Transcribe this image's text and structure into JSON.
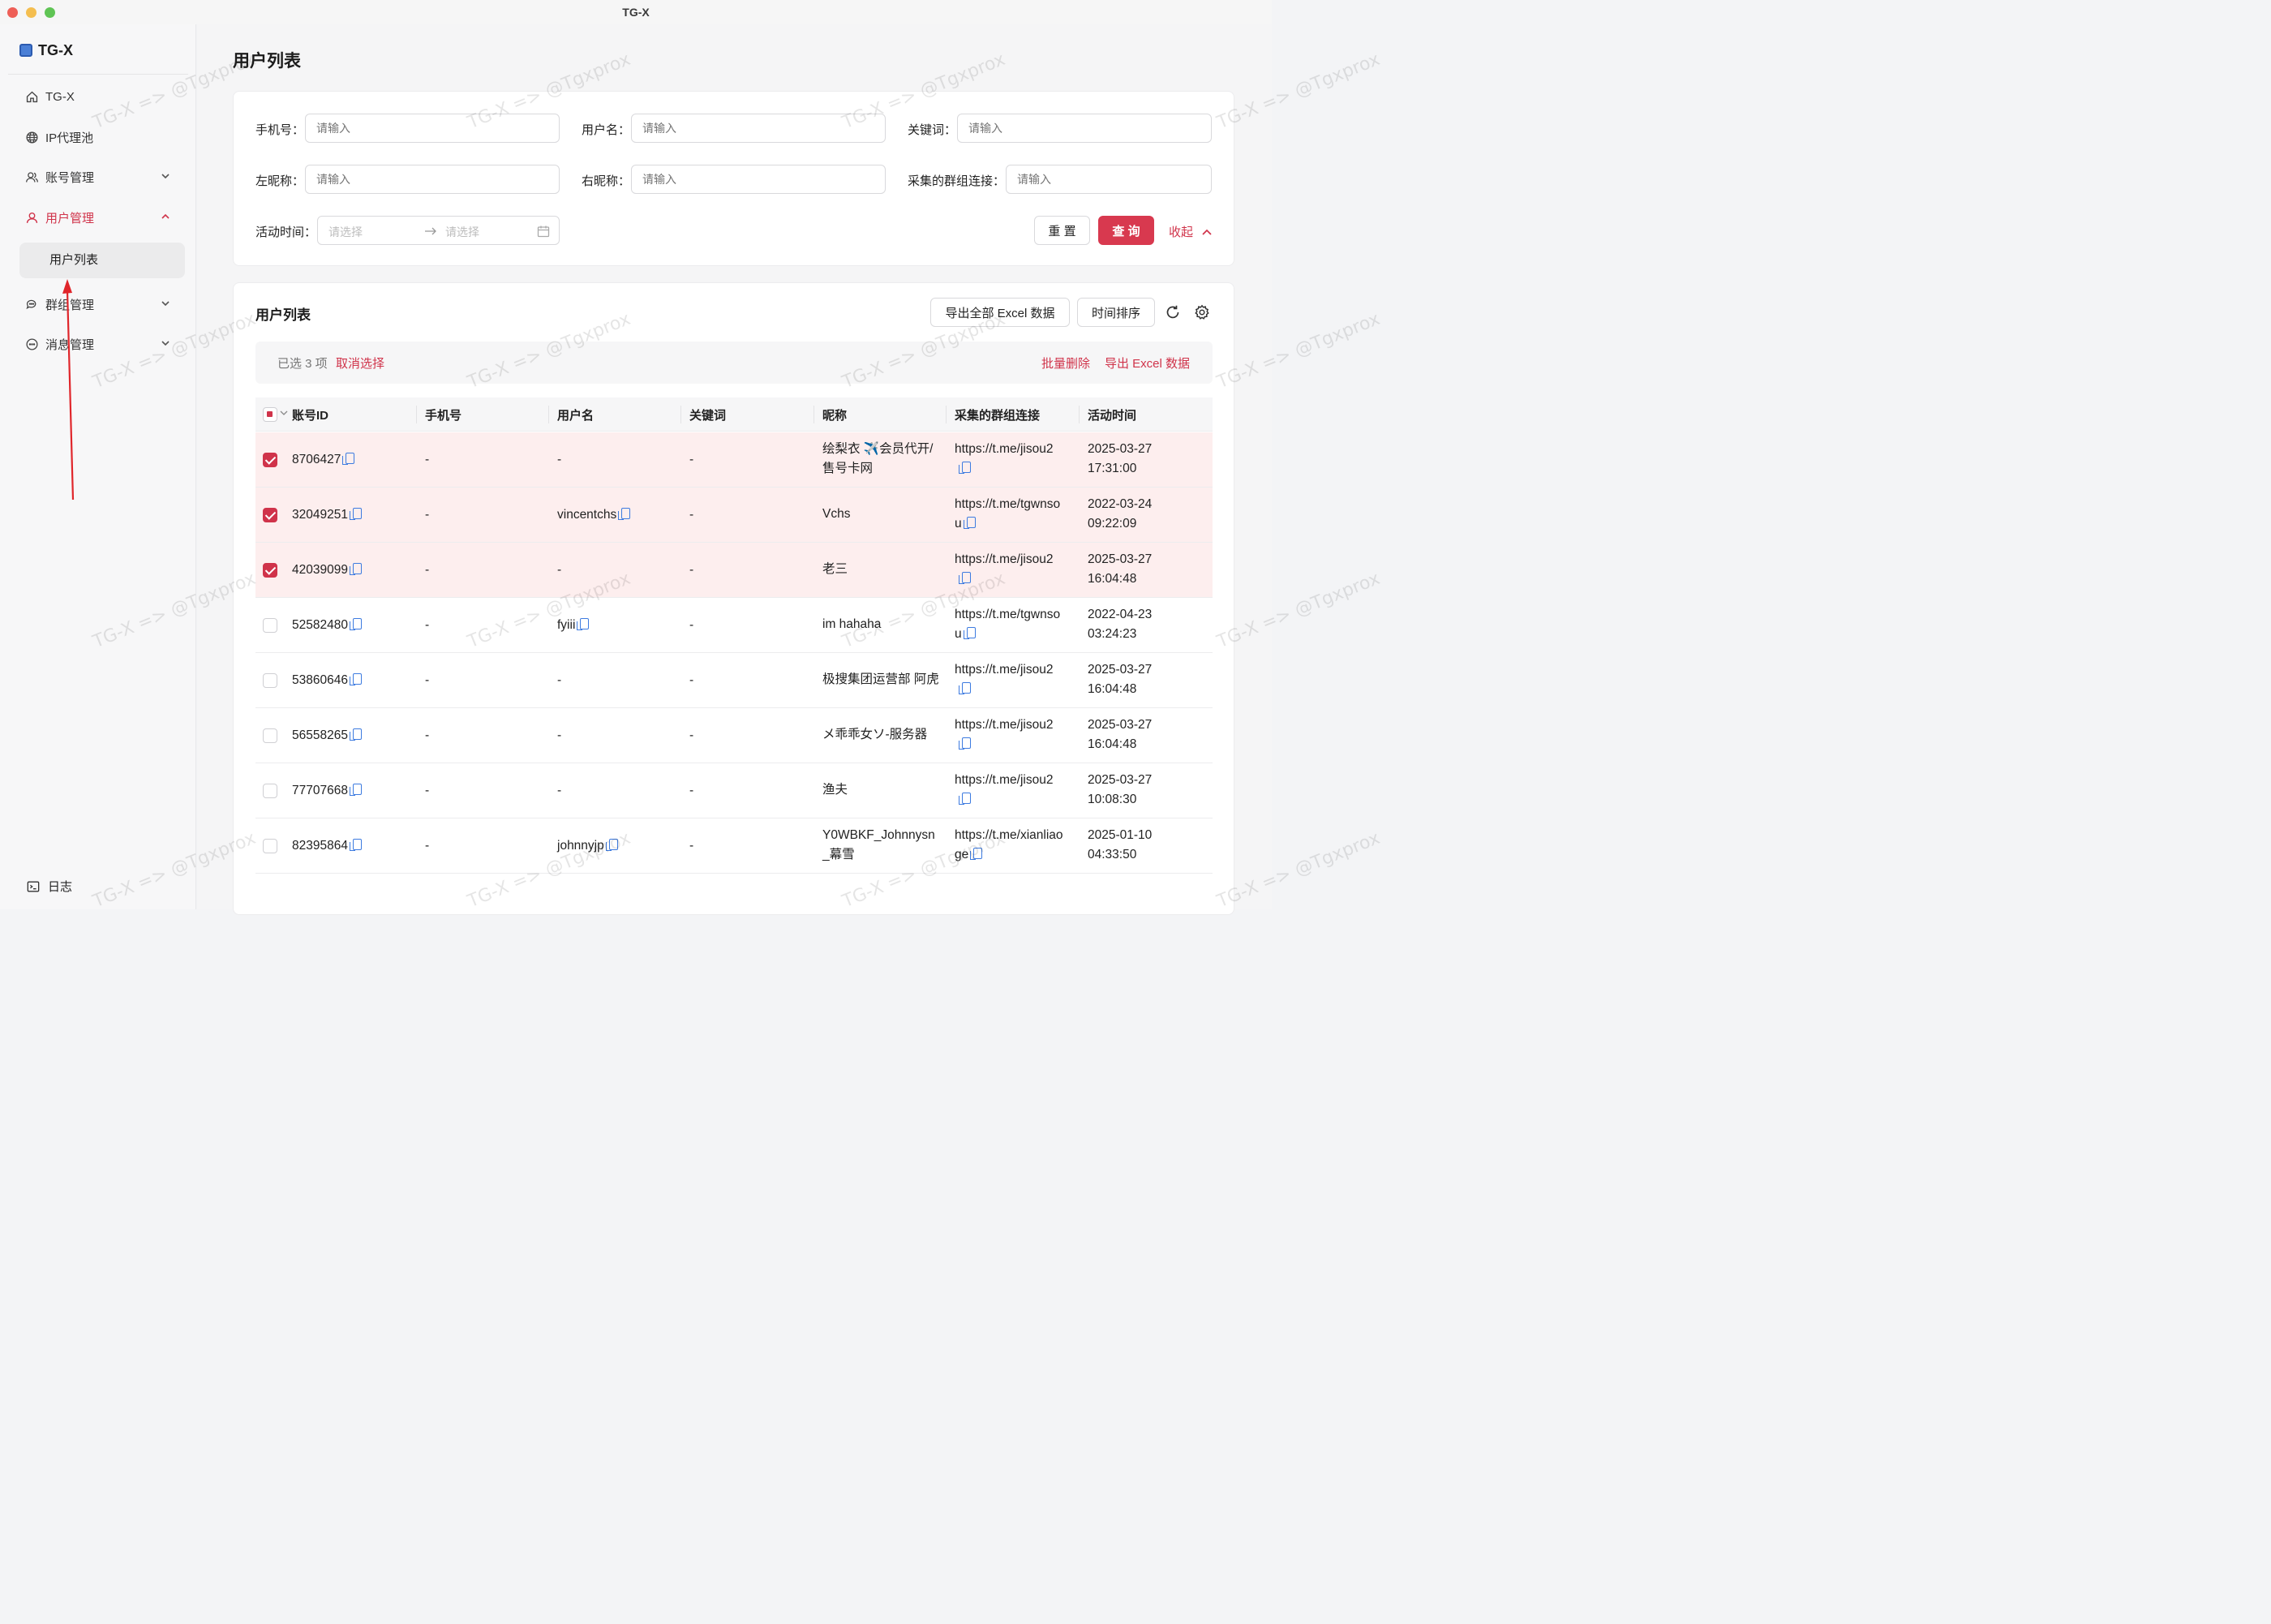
{
  "window": {
    "title": "TG-X"
  },
  "sidebar": {
    "brand": "TG-X",
    "items": [
      {
        "label": "TG-X",
        "icon": "home-icon"
      },
      {
        "label": "IP代理池",
        "icon": "globe-icon"
      },
      {
        "label": "账号管理",
        "icon": "user-group-icon"
      },
      {
        "label": "用户管理",
        "icon": "user-icon"
      },
      {
        "label": "群组管理",
        "icon": "chat-icon"
      },
      {
        "label": "消息管理",
        "icon": "message-icon"
      }
    ],
    "sub_item": "用户列表",
    "log": "日志"
  },
  "page": {
    "title": "用户列表"
  },
  "filters": {
    "phone_label": "手机号：",
    "username_label": "用户名：",
    "keyword_label": "关键词：",
    "left_nick_label": "左昵称：",
    "right_nick_label": "右昵称：",
    "group_link_label": "采集的群组连接：",
    "active_time_label": "活动时间：",
    "input_placeholder": "请输入",
    "date_placeholder": "请选择",
    "reset": "重 置",
    "query": "查 询",
    "collapse": "收起"
  },
  "list": {
    "title": "用户列表",
    "export_all": "导出全部 Excel 数据",
    "sort_time": "时间排序",
    "selected_text": "已选 3 项",
    "cancel_select": "取消选择",
    "batch_delete": "批量删除",
    "export_excel": "导出 Excel 数据",
    "columns": [
      "账号ID",
      "手机号",
      "用户名",
      "关键词",
      "昵称",
      "采集的群组连接",
      "活动时间"
    ],
    "rows": [
      {
        "selected": true,
        "id": "8706427",
        "phone": "-",
        "username": "-",
        "username_copy": false,
        "keyword": "-",
        "nick1": "绘梨衣 ✈️会员代开/",
        "nick2": "售号卡网",
        "link1": "https://t.me/jisou2",
        "link2": "",
        "date": "2025-03-27",
        "time": "17:31:00"
      },
      {
        "selected": true,
        "id": "32049251",
        "phone": "-",
        "username": "vincentchs",
        "username_copy": true,
        "keyword": "-",
        "nick1": "Vchs",
        "nick2": "",
        "link1": "https://t.me/tgwnso",
        "link2": "u",
        "date": "2022-03-24",
        "time": "09:22:09"
      },
      {
        "selected": true,
        "id": "42039099",
        "phone": "-",
        "username": "-",
        "username_copy": false,
        "keyword": "-",
        "nick1": "老三",
        "nick2": "",
        "link1": "https://t.me/jisou2",
        "link2": "",
        "date": "2025-03-27",
        "time": "16:04:48"
      },
      {
        "selected": false,
        "id": "52582480",
        "phone": "-",
        "username": "fyiii",
        "username_copy": true,
        "keyword": "-",
        "nick1": "im hahaha",
        "nick2": "",
        "link1": "https://t.me/tgwnso",
        "link2": "u",
        "date": "2022-04-23",
        "time": "03:24:23"
      },
      {
        "selected": false,
        "id": "53860646",
        "phone": "-",
        "username": "-",
        "username_copy": false,
        "keyword": "-",
        "nick1": "极搜集团运营部 阿虎",
        "nick2": "",
        "link1": "https://t.me/jisou2",
        "link2": "",
        "date": "2025-03-27",
        "time": "16:04:48"
      },
      {
        "selected": false,
        "id": "56558265",
        "phone": "-",
        "username": "-",
        "username_copy": false,
        "keyword": "-",
        "nick1": "メ乖乖女ソ-服务器",
        "nick2": "",
        "link1": "https://t.me/jisou2",
        "link2": "",
        "date": "2025-03-27",
        "time": "16:04:48"
      },
      {
        "selected": false,
        "id": "77707668",
        "phone": "-",
        "username": "-",
        "username_copy": false,
        "keyword": "-",
        "nick1": "渔夫",
        "nick2": "",
        "link1": "https://t.me/jisou2",
        "link2": "",
        "date": "2025-03-27",
        "time": "10:08:30"
      },
      {
        "selected": false,
        "id": "82395864",
        "phone": "-",
        "username": "johnnyjp",
        "username_copy": true,
        "keyword": "-",
        "nick1": "Y0WBKF_Johnnysn",
        "nick2": "_幕雪",
        "link1": "https://t.me/xianliao",
        "link2": "ge",
        "date": "2025-01-10",
        "time": "04:33:50"
      }
    ]
  },
  "watermark": "TG-X => @Tgxprox",
  "colors": {
    "accent": "#d0334a",
    "selected_row": "#fdeeee",
    "copy_icon": "#3d7be0"
  }
}
